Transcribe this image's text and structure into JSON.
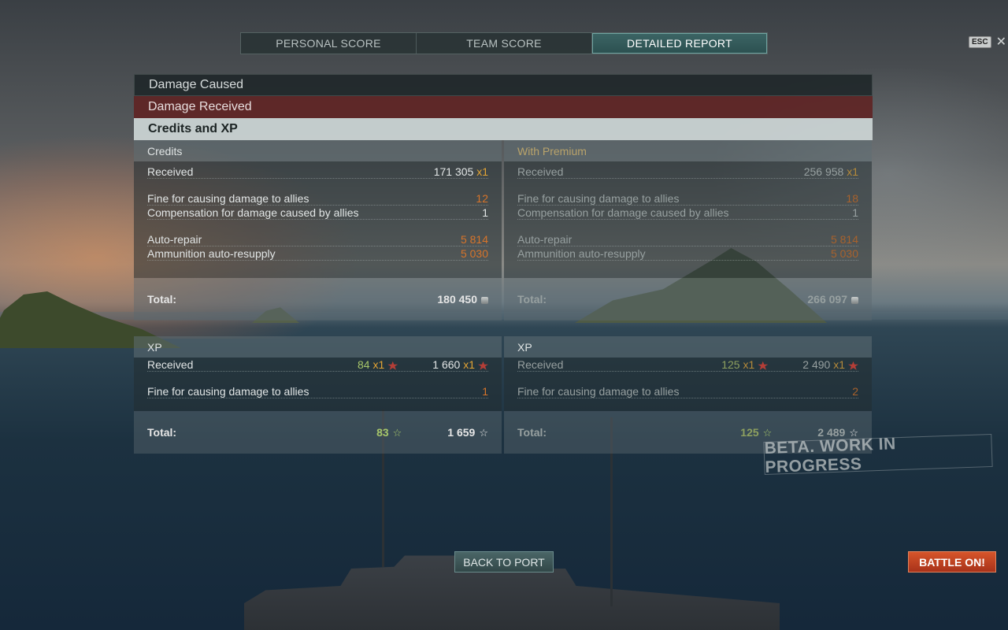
{
  "tabs": [
    {
      "label": "PERSONAL SCORE",
      "active": false
    },
    {
      "label": "TEAM SCORE",
      "active": false
    },
    {
      "label": "DETAILED REPORT",
      "active": true
    }
  ],
  "esc": {
    "key": "ESC",
    "close": "✕"
  },
  "sections": {
    "damage_caused": "Damage Caused",
    "damage_received": "Damage Received",
    "credits_and_xp": "Credits and XP"
  },
  "credits": {
    "standard": {
      "header": "Credits",
      "received_label": "Received",
      "received_value": "171 305",
      "received_mult": "x1",
      "fine_label": "Fine for causing damage to allies",
      "fine_value": "12",
      "comp_label": "Compensation for damage caused by allies",
      "comp_value": "1",
      "repair_label": "Auto-repair",
      "repair_value": "5 814",
      "resupply_label": "Ammunition auto-resupply",
      "resupply_value": "5 030",
      "total_label": "Total:",
      "total_value": "180 450"
    },
    "premium": {
      "header": "With Premium",
      "received_label": "Received",
      "received_value": "256 958",
      "received_mult": "x1",
      "fine_label": "Fine for causing damage to allies",
      "fine_value": "18",
      "comp_label": "Compensation for damage caused by allies",
      "comp_value": "1",
      "repair_label": "Auto-repair",
      "repair_value": "5 814",
      "resupply_label": "Ammunition auto-resupply",
      "resupply_value": "5 030",
      "total_label": "Total:",
      "total_value": "266 097"
    }
  },
  "xp": {
    "standard": {
      "header": "XP",
      "received_label": "Received",
      "received_ship": "84",
      "received_ship_mult": "x1",
      "received_total": "1 660",
      "received_total_mult": "x1",
      "fine_label": "Fine for causing damage to allies",
      "fine_value": "1",
      "total_label": "Total:",
      "total_ship": "83",
      "total_total": "1 659"
    },
    "premium": {
      "header": "XP",
      "received_label": "Received",
      "received_ship": "125",
      "received_ship_mult": "x1",
      "received_total": "2 490",
      "received_total_mult": "x1",
      "fine_label": "Fine for causing damage to allies",
      "fine_value": "2",
      "total_label": "Total:",
      "total_ship": "125",
      "total_total": "2 489"
    }
  },
  "buttons": {
    "back_to_port": "BACK TO PORT",
    "battle_on": "BATTLE ON!"
  },
  "watermark": "BETA. WORK IN PROGRESS",
  "colors": {
    "accent_teal": "#3c6565",
    "battle_orange": "#d6552a",
    "negative": "#d7742a",
    "damage_received_bar": "#5f2323"
  },
  "icons": {
    "credit": "credit-coin-icon",
    "xp": "xp-star-icon",
    "free_xp": "star-outline-icon"
  }
}
